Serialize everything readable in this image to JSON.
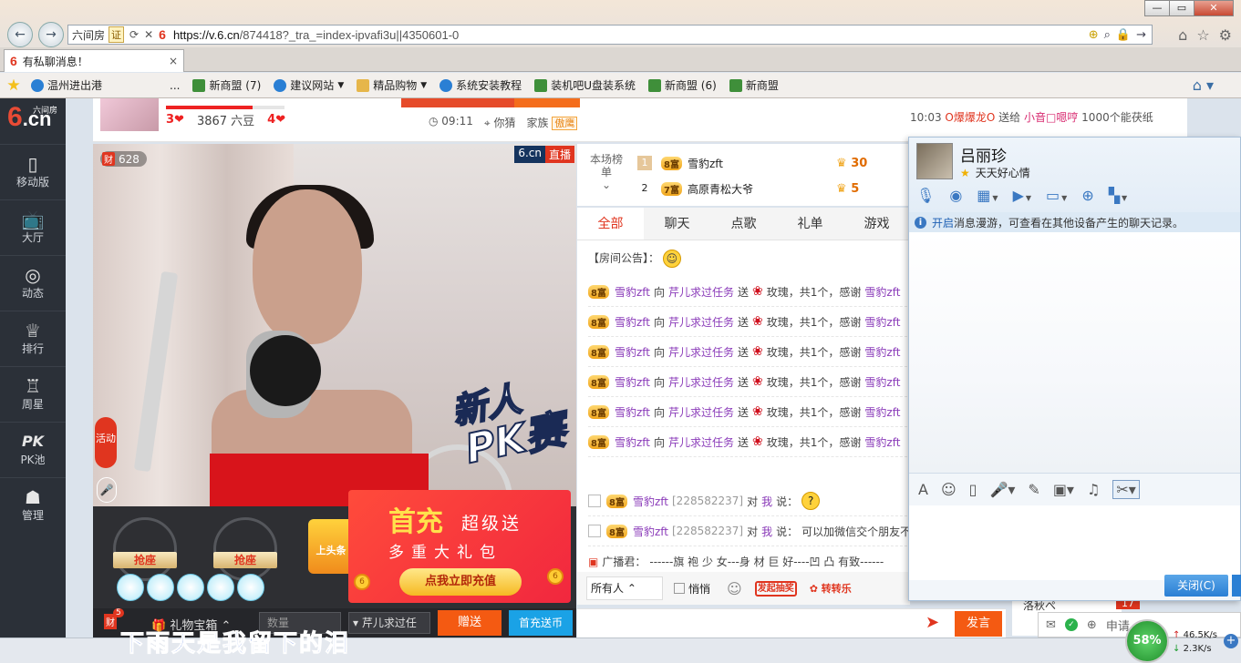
{
  "browser": {
    "site_label": "六间房",
    "cert_label": "证",
    "url_host": "https://v.6.cn",
    "url_path": "/874418?_tra_=index-ipvafi3u||4350601-0",
    "tab_title": "有私聊消息！",
    "tab_close": "×",
    "favorites": [
      {
        "label": "温州进出港",
        "icon": "ie",
        "dropdown": false
      },
      {
        "label": "...",
        "icon": "",
        "dropdown": false
      },
      {
        "label": "新商盟 (7)",
        "icon": "clover",
        "dropdown": false
      },
      {
        "label": "建议网站",
        "icon": "ie",
        "dropdown": true
      },
      {
        "label": "精品购物",
        "icon": "folder",
        "dropdown": true
      },
      {
        "label": "系统安装教程",
        "icon": "ie",
        "dropdown": false
      },
      {
        "label": "装机吧U盘装系统",
        "icon": "clover",
        "dropdown": false
      },
      {
        "label": "新商盟 (6)",
        "icon": "clover",
        "dropdown": false
      },
      {
        "label": "新商盟",
        "icon": "clover",
        "dropdown": false
      }
    ]
  },
  "leftnav": {
    "brand_six": "6",
    "brand_cn": ".cn",
    "brand_small": "六间房",
    "items": [
      {
        "label": "移动版",
        "icon": "▯"
      },
      {
        "label": "大厅",
        "icon": "📺"
      },
      {
        "label": "动态",
        "icon": "◎"
      },
      {
        "label": "排行",
        "icon": "♕"
      },
      {
        "label": "周星",
        "icon": "♖"
      },
      {
        "label": "PK池",
        "icon": "PK"
      },
      {
        "label": "管理",
        "icon": "☗"
      }
    ]
  },
  "streamer": {
    "hearts_left": "3❤",
    "beans": "3867 六豆",
    "hearts_right": "4❤",
    "time": "09:11",
    "guess": "你猜",
    "family": "家族",
    "family_tag": "傲鹰",
    "marquee": {
      "time": "10:03",
      "sender": "O爆爆龙O",
      "action": "送给",
      "receiver": "小音□嗯哼",
      "item": "1000个能茯纸"
    }
  },
  "video": {
    "viewer_badge": "财",
    "viewer_count": "628",
    "live_site": "6.cn",
    "live_label": "直播",
    "pk_line1": "新人",
    "pk_line2": "PK赛",
    "activity_label": "活动"
  },
  "seats": {
    "seat_label": "抢座",
    "shangtou": "上头条"
  },
  "promo": {
    "title": "首充",
    "subtitle": "超级送",
    "line2": "多重大礼包",
    "button": "点我立即充值",
    "coin": "6"
  },
  "giftrow": {
    "badge": "财",
    "badge_count": "5",
    "gift_box": "礼物宝箱",
    "qty_placeholder": "数量",
    "to": "芹儿求过任",
    "send": "赠送",
    "recharge": "首充送币"
  },
  "rank": {
    "label": "本场榜单",
    "rows": [
      {
        "num": "1",
        "level": "8富",
        "name": "雪豹zft",
        "score": "30"
      },
      {
        "num": "2",
        "level": "7富",
        "name": "高原青松大爷",
        "score": "5"
      }
    ]
  },
  "tabs": [
    "全部",
    "聊天",
    "点歌",
    "礼单",
    "游戏"
  ],
  "chat": {
    "notice": "【房间公告】：",
    "gift_rows": [
      {
        "level": "8富",
        "user": "雪豹zft",
        "to_word": "向",
        "target": "芹儿求过任务",
        "give": "送",
        "item": "玫瑰，共1个，感谢",
        "thanks_user": "雪豹zft"
      },
      {
        "level": "8富",
        "user": "雪豹zft",
        "to_word": "向",
        "target": "芹儿求过任务",
        "give": "送",
        "item": "玫瑰，共1个，感谢",
        "thanks_user": "雪豹zft"
      },
      {
        "level": "8富",
        "user": "雪豹zft",
        "to_word": "向",
        "target": "芹儿求过任务",
        "give": "送",
        "item": "玫瑰，共1个，感谢",
        "thanks_user": "雪豹zft"
      },
      {
        "level": "8富",
        "user": "雪豹zft",
        "to_word": "向",
        "target": "芹儿求过任务",
        "give": "送",
        "item": "玫瑰，共1个，感谢",
        "thanks_user": "雪豹zft"
      },
      {
        "level": "8富",
        "user": "雪豹zft",
        "to_word": "向",
        "target": "芹儿求过任务",
        "give": "送",
        "item": "玫瑰，共1个，感谢",
        "thanks_user": "雪豹zft"
      },
      {
        "level": "8富",
        "user": "雪豹zft",
        "to_word": "向",
        "target": "芹儿求过任务",
        "give": "送",
        "item": "玫瑰，共1个，感谢",
        "thanks_user": "雪豹zft"
      }
    ],
    "msg_rows": [
      {
        "level": "8富",
        "user": "雪豹zft",
        "uid": "[228582237]",
        "to_word": "对",
        "me": "我",
        "says": "说：",
        "text": ""
      },
      {
        "level": "8富",
        "user": "雪豹zft",
        "uid": "[228582237]",
        "to_word": "对",
        "me": "我",
        "says": "说：",
        "text": "可以加微信交个朋友不"
      }
    ],
    "broadcast_label": "广播君：",
    "broadcast_text": "------旗 袍 少 女---身 材 巨 好----凹 凸 有致------"
  },
  "chatctl": {
    "audience": "所有人",
    "private": "悄悄",
    "red_packet": "发起抽奖",
    "spin": "转转乐"
  },
  "sendbar": {
    "send": "发言"
  },
  "side": {
    "label": "洛秋ぺ",
    "count": "17"
  },
  "qq": {
    "name": "吕丽珍",
    "signature": "天天好心情",
    "info_link": "开启",
    "info_text": "消息漫游，可查看在其他设备产生的聊天记录。",
    "close": "关闭(C)"
  },
  "lyric": "下雨天是我留下的泪",
  "tray": {
    "apply": "申请"
  },
  "netmon": {
    "percent": "58%",
    "up": "46.5K/s",
    "down": "2.3K/s"
  }
}
